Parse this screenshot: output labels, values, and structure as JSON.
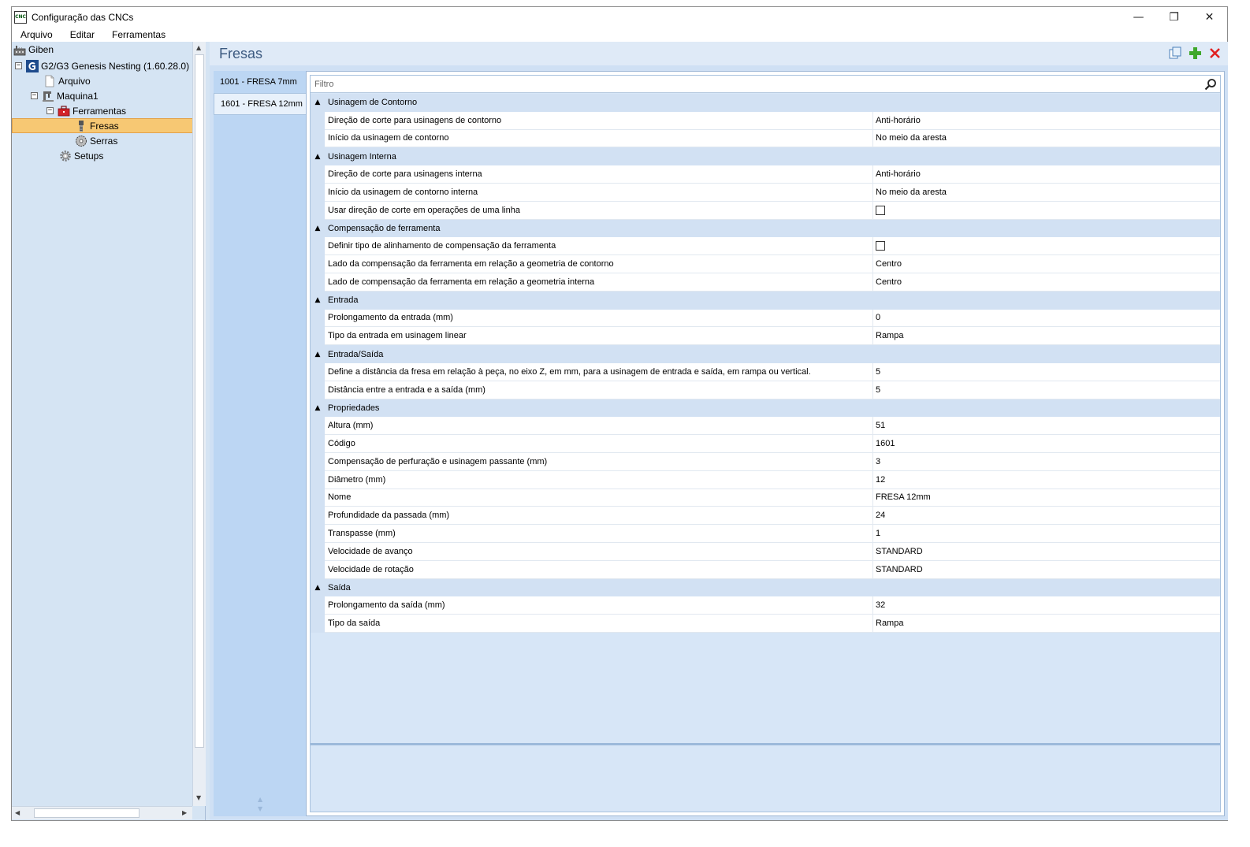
{
  "window": {
    "title": "Configuração das CNCs",
    "app_icon_text": "CNC",
    "controls": {
      "minimize": "—",
      "maximize": "❐",
      "close": "✕"
    }
  },
  "menu": [
    "Arquivo",
    "Editar",
    "Ferramentas"
  ],
  "tree": {
    "root": "Giben",
    "machine_group": "G2/G3 Genesis Nesting (1.60.28.0)",
    "arquivo": "Arquivo",
    "maquina": "Maquina1",
    "ferramentas": "Ferramentas",
    "fresas": "Fresas",
    "serras": "Serras",
    "setups": "Setups",
    "expander_minus": "−"
  },
  "content": {
    "title": "Fresas",
    "tools": [
      {
        "label": "1001 - FRESA 7mm",
        "active": false
      },
      {
        "label": "1601 - FRESA 12mm",
        "active": true
      }
    ],
    "filter_placeholder": "Filtro"
  },
  "grid": {
    "collapse_glyph": "▲",
    "rows": [
      {
        "type": "group",
        "label": "Usinagem de Contorno"
      },
      {
        "type": "prop",
        "name": "Direção de corte para usinagens de contorno",
        "value": "Anti-horário"
      },
      {
        "type": "prop",
        "name": "Início da usinagem de contorno",
        "value": "No meio da aresta"
      },
      {
        "type": "group",
        "label": "Usinagem Interna"
      },
      {
        "type": "prop",
        "name": "Direção de corte para usinagens interna",
        "value": "Anti-horário"
      },
      {
        "type": "prop",
        "name": "Início da usinagem de contorno interna",
        "value": "No meio da aresta"
      },
      {
        "type": "prop",
        "name": "Usar direção de corte em operações de uma linha",
        "checkbox": true
      },
      {
        "type": "group",
        "label": "Compensação de ferramenta"
      },
      {
        "type": "prop",
        "name": "Definir tipo de alinhamento de compensação da ferramenta",
        "checkbox": true
      },
      {
        "type": "prop",
        "name": "Lado da compensação da ferramenta em relação a geometria de contorno",
        "value": "Centro"
      },
      {
        "type": "prop",
        "name": "Lado de compensação da ferramenta em relação a geometria interna",
        "value": "Centro"
      },
      {
        "type": "group",
        "label": "Entrada"
      },
      {
        "type": "prop",
        "name": "Prolongamento da entrada (mm)",
        "value": "0"
      },
      {
        "type": "prop",
        "name": "Tipo da entrada em usinagem linear",
        "value": "Rampa"
      },
      {
        "type": "group",
        "label": "Entrada/Saída"
      },
      {
        "type": "prop",
        "name": "Define a distância da fresa em relação à peça, no eixo Z, em mm, para a usinagem de entrada e saída, em rampa ou vertical.",
        "value": "5"
      },
      {
        "type": "prop",
        "name": "Distância entre a entrada e a saída (mm)",
        "value": "5"
      },
      {
        "type": "group",
        "label": "Propriedades"
      },
      {
        "type": "prop",
        "name": "Altura (mm)",
        "value": "51"
      },
      {
        "type": "prop",
        "name": "Código",
        "value": "1601"
      },
      {
        "type": "prop",
        "name": "Compensação de perfuração e usinagem passante (mm)",
        "value": "3"
      },
      {
        "type": "prop",
        "name": "Diâmetro (mm)",
        "value": "12"
      },
      {
        "type": "prop",
        "name": "Nome",
        "value": "FRESA 12mm"
      },
      {
        "type": "prop",
        "name": "Profundidade da passada (mm)",
        "value": "24"
      },
      {
        "type": "prop",
        "name": "Transpasse (mm)",
        "value": "1"
      },
      {
        "type": "prop",
        "name": "Velocidade de avanço",
        "value": "STANDARD"
      },
      {
        "type": "prop",
        "name": "Velocidade de rotação",
        "value": "STANDARD"
      },
      {
        "type": "group",
        "label": "Saída"
      },
      {
        "type": "prop",
        "name": "Prolongamento da saída (mm)",
        "value": "32"
      },
      {
        "type": "prop",
        "name": "Tipo da saída",
        "value": "Rampa"
      }
    ]
  },
  "colors": {
    "accent": "#3c5a80",
    "selection": "#f7c873",
    "panel": "#d5e4f3"
  }
}
